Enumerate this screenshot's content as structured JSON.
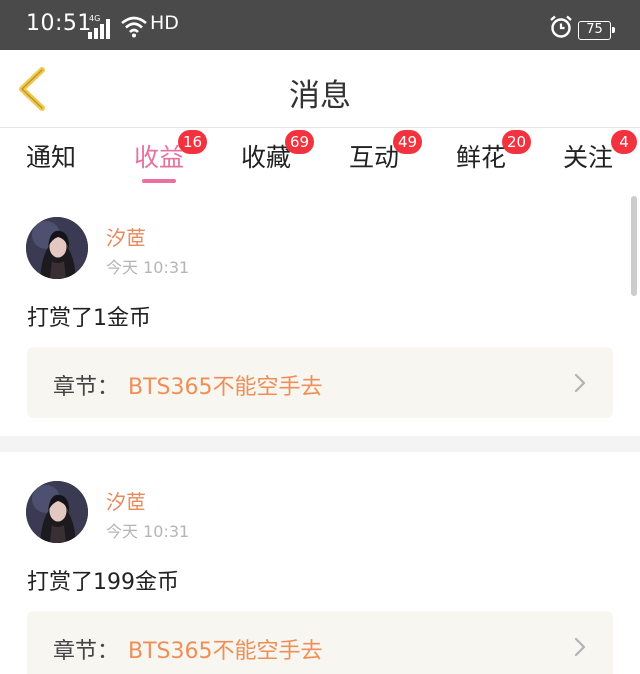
{
  "status_bar": {
    "time": "10:51",
    "network": "4G",
    "hd": "HD",
    "battery": "75"
  },
  "header": {
    "title": "消息",
    "back_icon": "chevron-left-icon"
  },
  "tabs": [
    {
      "label": "通知",
      "badge": ""
    },
    {
      "label": "收益",
      "badge": "16"
    },
    {
      "label": "收藏",
      "badge": "69"
    },
    {
      "label": "互动",
      "badge": "49"
    },
    {
      "label": "鲜花",
      "badge": "20"
    },
    {
      "label": "关注",
      "badge": "4"
    }
  ],
  "active_tab": "收益",
  "colors": {
    "accent": "#e8729f",
    "badge": "#f2333f",
    "username": "#e8895e",
    "chapter_title": "#ef8f56"
  },
  "feed": [
    {
      "user": "汐茝",
      "time": "今天 10:31",
      "message": "打赏了1金币",
      "chapter_label": "章节：",
      "chapter_title": "BTS365不能空手去"
    },
    {
      "user": "汐茝",
      "time": "今天 10:31",
      "message": "打赏了199金币",
      "chapter_label": "章节：",
      "chapter_title": "BTS365不能空手去"
    }
  ]
}
